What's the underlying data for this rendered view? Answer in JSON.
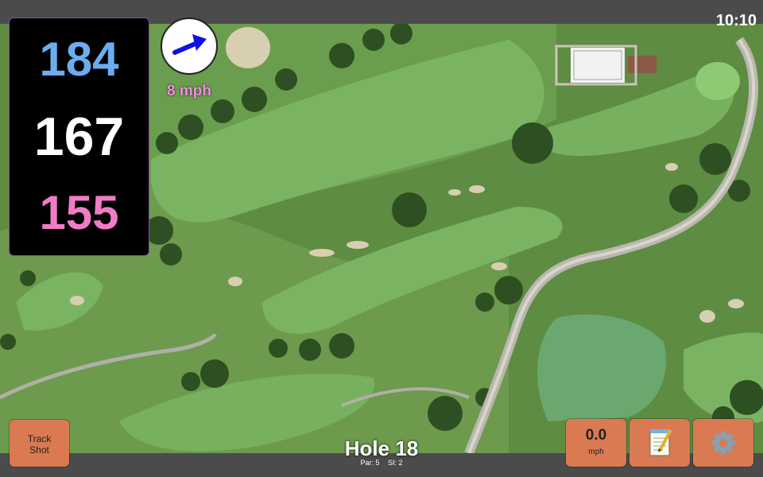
{
  "status": {
    "time": "10:10"
  },
  "distances": {
    "back": "184",
    "middle": "167",
    "front": "155"
  },
  "wind": {
    "speed": "8 mph",
    "icon": "arrow-right-icon",
    "arrow_color": "#1010e0"
  },
  "track_shot": {
    "line1": "Track",
    "line2": "Shot"
  },
  "hole": {
    "title": "Hole 18",
    "par": "Par: 5",
    "si": "SI: 2"
  },
  "speed": {
    "value": "0.0",
    "unit": "mph"
  },
  "notes": {
    "icon": "notepad-icon",
    "glyph": "📝"
  },
  "settings": {
    "icon": "gear-icon",
    "glyph": "⚙"
  },
  "colors": {
    "back": "#6aaef0",
    "middle": "#ffffff",
    "front": "#f07cc6",
    "button": "#d97a52"
  }
}
